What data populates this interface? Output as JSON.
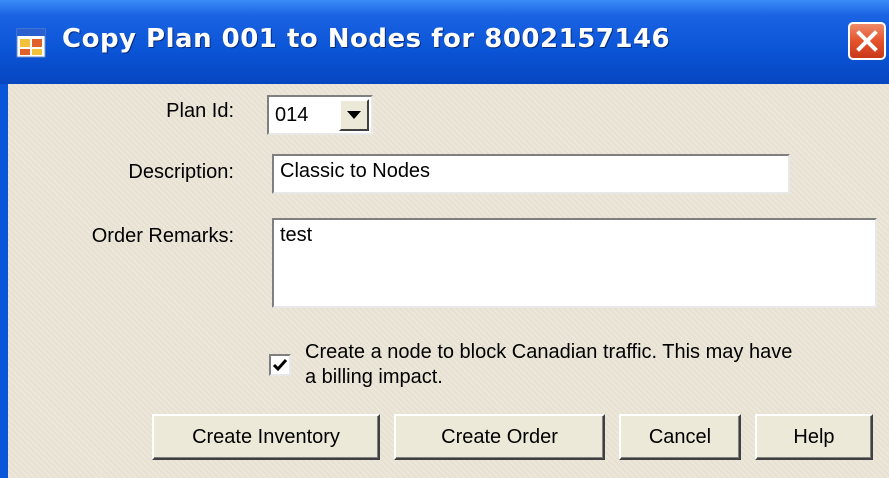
{
  "window": {
    "title": "Copy Plan 001 to Nodes for 8002157146"
  },
  "form": {
    "plan_id_label": "Plan Id:",
    "plan_id_value": "014",
    "description_label": "Description:",
    "description_value": "Classic to Nodes",
    "order_remarks_label": "Order Remarks:",
    "order_remarks_value": "test",
    "block_canadian_checked": true,
    "block_canadian_label": "Create a node to block Canadian traffic. This may have a billing impact."
  },
  "buttons": {
    "create_inventory": "Create Inventory",
    "create_order": "Create Order",
    "cancel": "Cancel",
    "help": "Help"
  },
  "icons": {
    "app": "window-app-icon",
    "close": "close-icon",
    "dropdown": "chevron-down-icon",
    "check": "checkmark-icon"
  },
  "colors": {
    "titlebar": "#0a54d6",
    "client_background": "#ece6d8",
    "close_button": "#e4532c"
  }
}
